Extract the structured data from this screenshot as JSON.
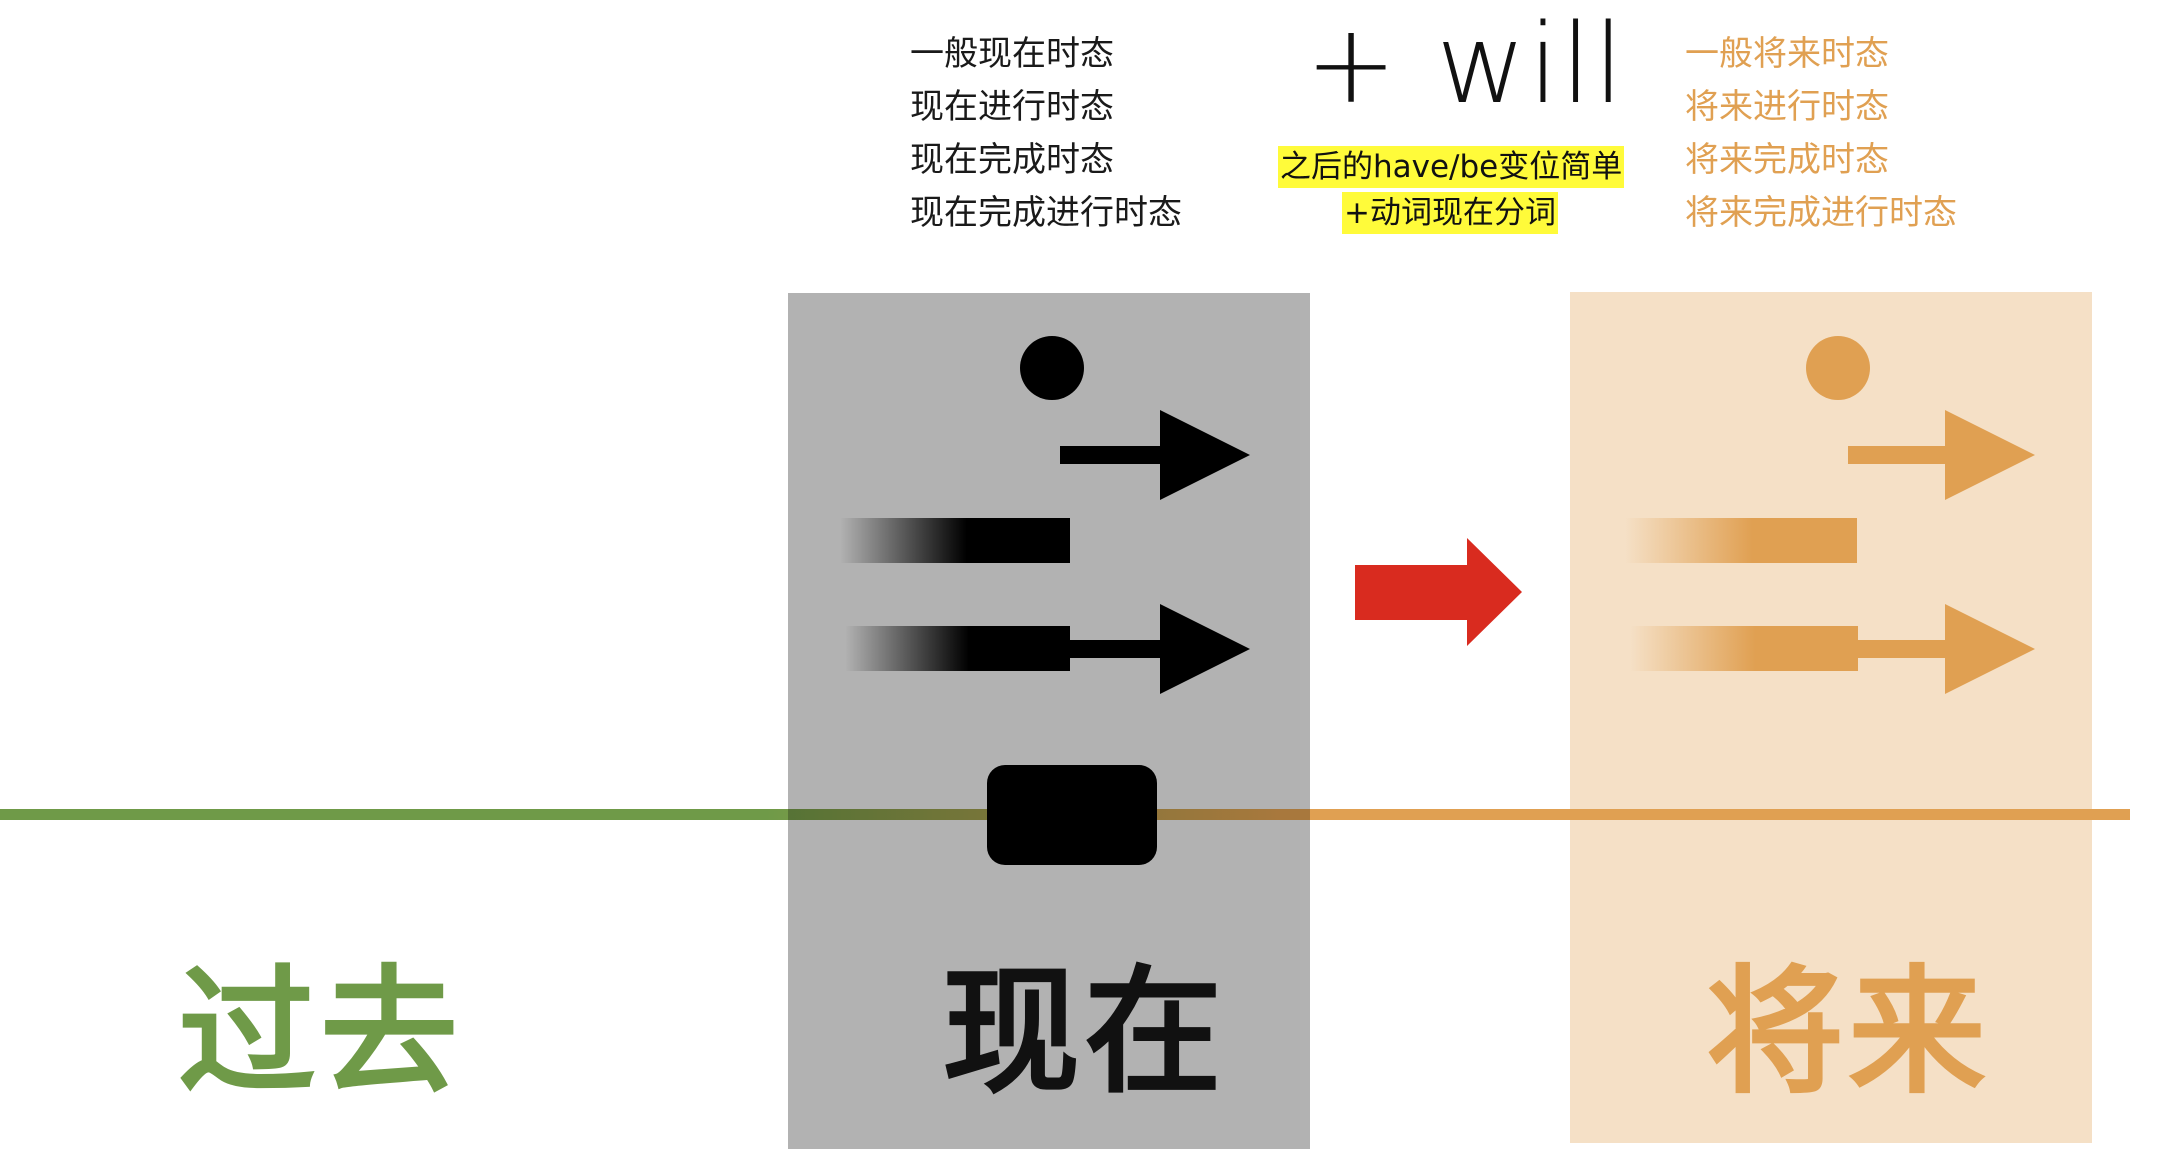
{
  "present": {
    "tenses": [
      "一般现在时态",
      "现在进行时态",
      "现在完成时态",
      "现在完成进行时态"
    ],
    "label": "现在"
  },
  "transform": {
    "word": "+ will",
    "note_line1": "之后的have/be变位简单",
    "note_line2": "+动词现在分词"
  },
  "future": {
    "tenses": [
      "一般将来时态",
      "将来进行时态",
      "将来完成时态",
      "将来完成进行时态"
    ],
    "label": "将来"
  },
  "past": {
    "label": "过去"
  },
  "colors": {
    "past": "#6f9a48",
    "present_box": "#b2b2b2",
    "future": "#e0a052",
    "future_box": "#f5e0c6",
    "arrow": "#d92b1f",
    "highlight": "#fffb3a"
  },
  "icons": [
    "simple-dot-icon",
    "progressive-arrow-icon",
    "perfect-bar-icon",
    "perfect-progressive-arrow-icon",
    "transition-arrow-icon",
    "now-marker-icon"
  ]
}
